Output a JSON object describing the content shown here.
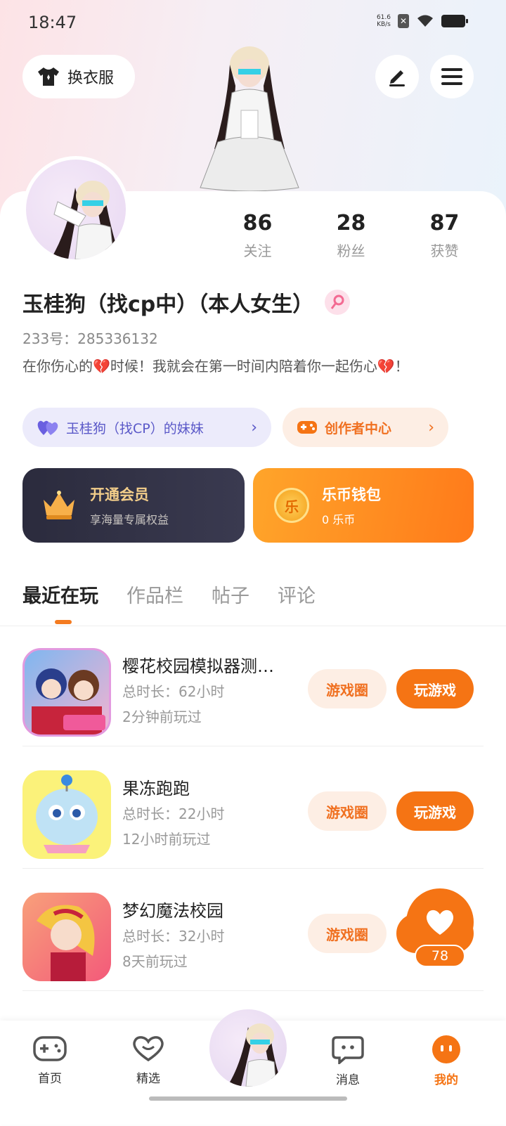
{
  "status": {
    "time": "18:47",
    "speed": "61.6\nKB/s"
  },
  "header": {
    "dress_label": "换衣服"
  },
  "profile": {
    "stats": [
      {
        "num": "86",
        "label": "关注"
      },
      {
        "num": "28",
        "label": "粉丝"
      },
      {
        "num": "87",
        "label": "获赞"
      }
    ],
    "name": "玉桂狗（找cp中）（本人女生）",
    "uid": "233号：285336132",
    "bio": "在你伤心的💔时候！我就会在第一时间内陪着你一起伤心💔！",
    "cp_tag": "玉桂狗（找CP）的妹妹",
    "creator_tag": "创作者中心"
  },
  "cards": {
    "vip_title": "开通会员",
    "vip_sub": "享海量专属权益",
    "wallet_title": "乐币钱包",
    "wallet_sub": "0 乐币",
    "coin_char": "乐"
  },
  "tabs": [
    "最近在玩",
    "作品栏",
    "帖子",
    "评论"
  ],
  "games": [
    {
      "name": "樱花校园模拟器测…",
      "duration": "总时长：62小时",
      "last": "2分钟前玩过",
      "circle_btn": "游戏圈",
      "play_btn": "玩游戏"
    },
    {
      "name": "果冻跑跑",
      "duration": "总时长：22小时",
      "last": "12小时前玩过",
      "circle_btn": "游戏圈",
      "play_btn": "玩游戏"
    },
    {
      "name": "梦幻魔法校园",
      "duration": "总时长：32小时",
      "last": "8天前玩过",
      "circle_btn": "游戏圈",
      "play_btn": "玩游戏"
    }
  ],
  "float_like": {
    "count": "78"
  },
  "nav": [
    {
      "label": "首页",
      "icon": "gamepad-icon"
    },
    {
      "label": "精选",
      "icon": "heart-icon"
    },
    {
      "label": "消息",
      "icon": "chat-icon"
    },
    {
      "label": "我的",
      "icon": "face-icon"
    }
  ],
  "colors": {
    "accent": "#f57414",
    "cp_purple": "#5a58c8",
    "vip_gold": "#f2cd8a"
  }
}
